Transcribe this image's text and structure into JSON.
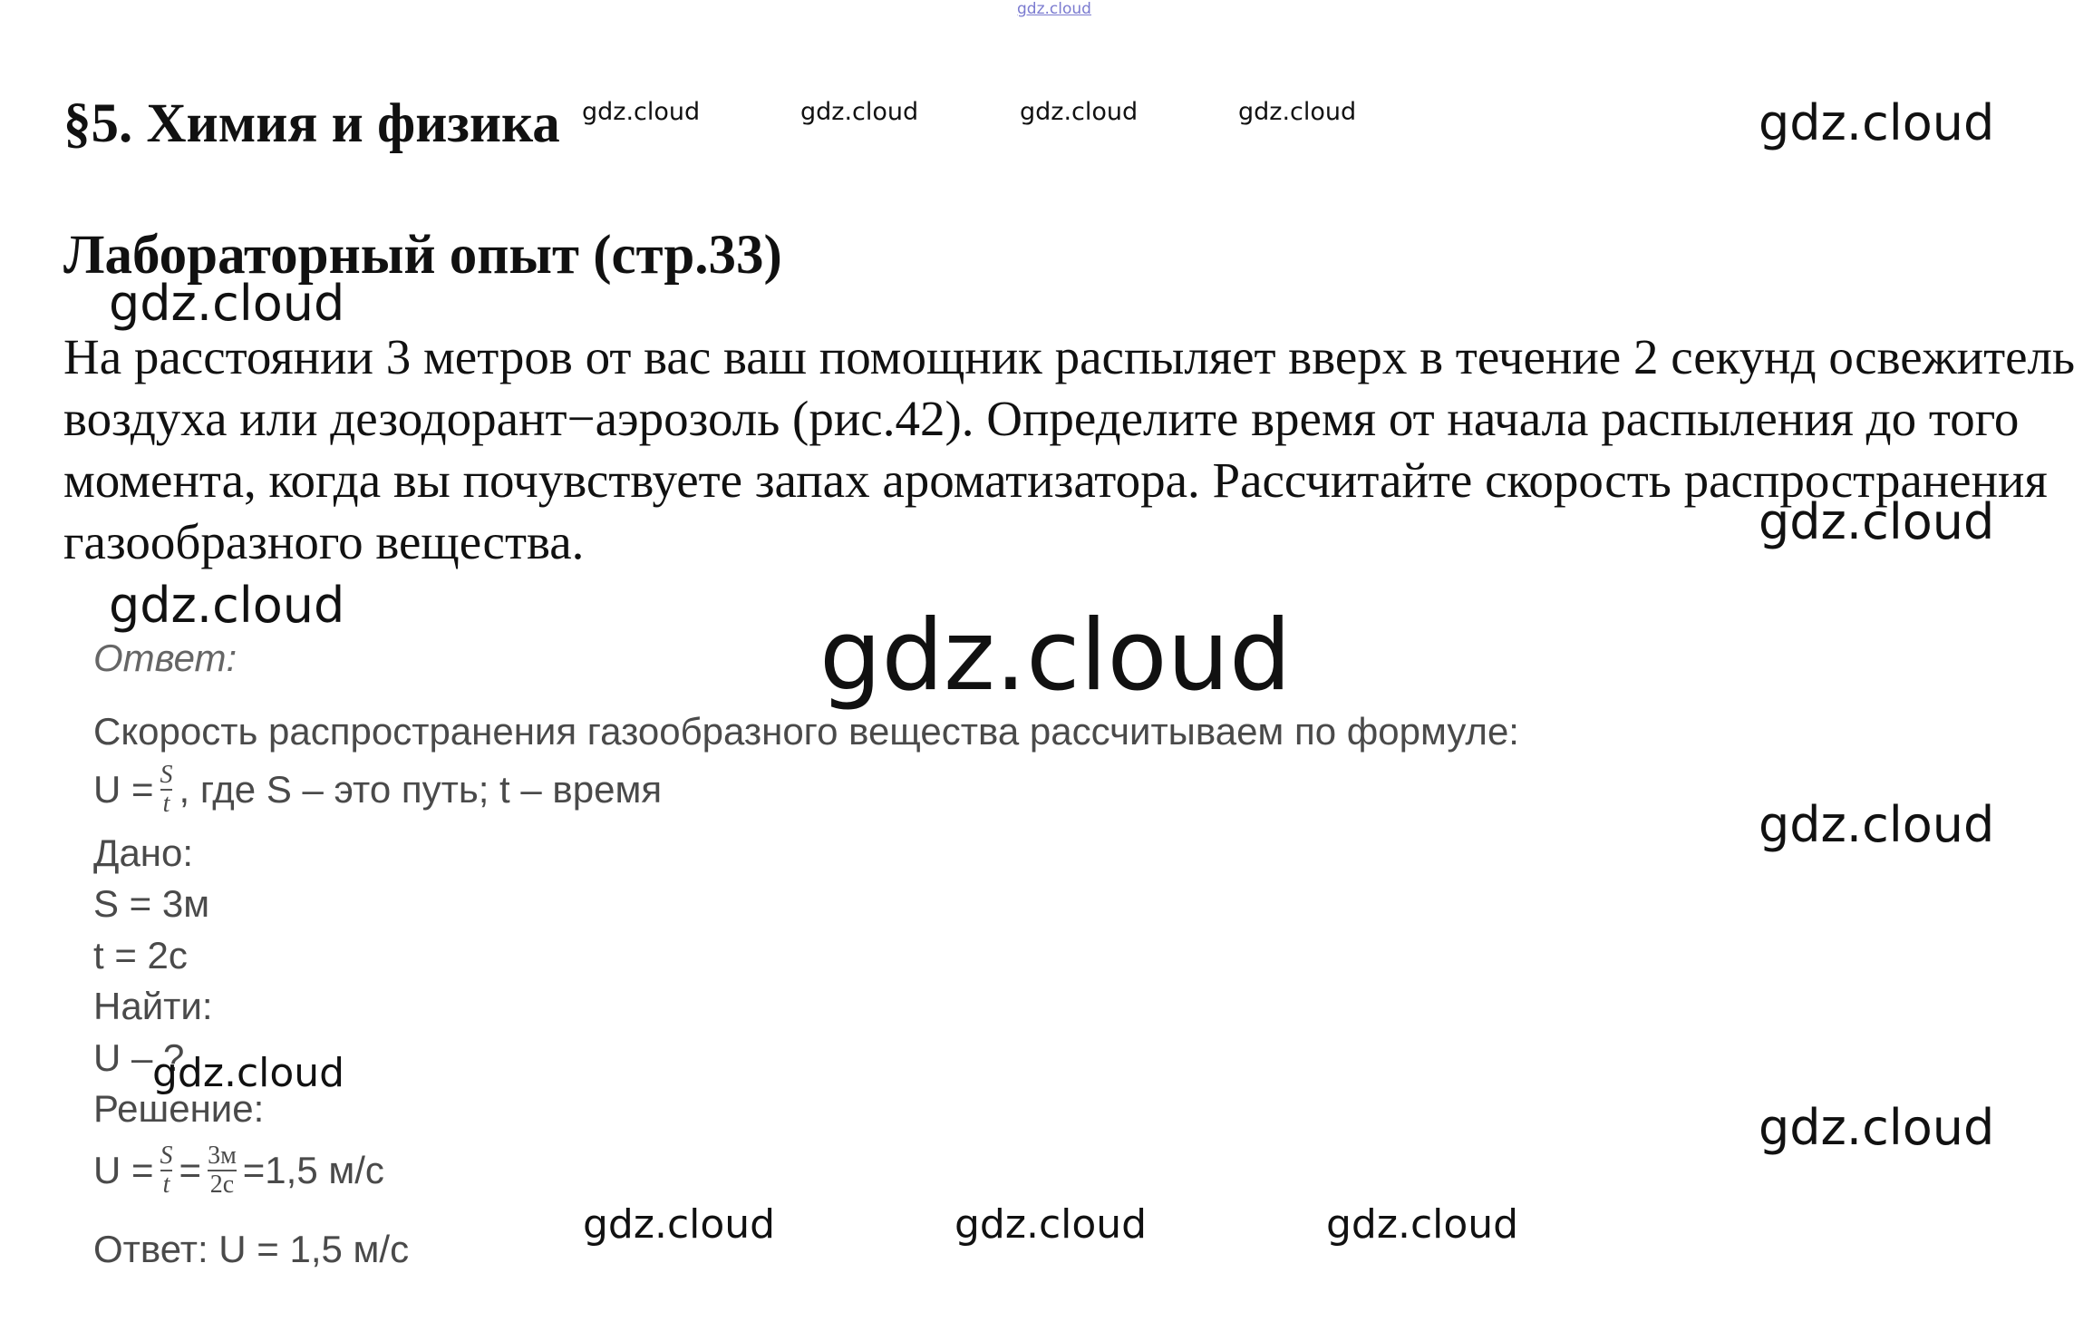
{
  "document": {
    "section_title": "§5. Химия и физика",
    "subtitle": "Лабораторный опыт (стр.33)",
    "problem_text": "На расстоянии 3 метров от вас ваш помощник распыляет вверх в течение 2 секунд освежитель воздуха или дезодорант−аэрозоль (рис.42). Определите время от начала распыления до того момента, когда вы почувствуете запах ароматизатора. Рассчитайте скорость распространения газообразного вещества."
  },
  "answer": {
    "label": "Ответ:",
    "intro": "Скорость распространения газообразного вещества рассчитываем по формуле:",
    "formula_lhs": "U =",
    "formula_num": "S",
    "formula_den": "t",
    "formula_rest": ", где S – это путь; t – время",
    "given_label": "Дано:",
    "given_s": "S = 3м",
    "given_t": "t = 2с",
    "find_label": "Найти:",
    "find_value": "U – ?",
    "solution_label": "Решение:",
    "solution_lhs": "U =",
    "solution_num1": "S",
    "solution_den1": "t",
    "solution_eq": "=",
    "solution_num2": "3м",
    "solution_den2": "2с",
    "solution_result": "=1,5 м/с",
    "final": "Ответ: U = 1,5 м/с"
  },
  "watermark": {
    "text": "gdz.cloud"
  }
}
